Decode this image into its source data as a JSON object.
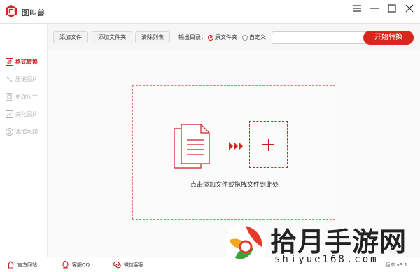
{
  "app": {
    "title": "图叫兽"
  },
  "window_controls": {
    "menu": "☰",
    "minimize": "—",
    "maximize": "☐",
    "close": "✕"
  },
  "sidebar": {
    "items": [
      {
        "label": "格式转换",
        "icon": "swap-icon",
        "active": true
      },
      {
        "label": "压缩图片",
        "icon": "compress-icon",
        "active": false
      },
      {
        "label": "更改尺寸",
        "icon": "resize-icon",
        "active": false
      },
      {
        "label": "美化图片",
        "icon": "beautify-icon",
        "active": false
      },
      {
        "label": "添加水印",
        "icon": "watermark-icon",
        "active": false
      }
    ]
  },
  "toolbar": {
    "add_file": "添加文件",
    "add_folder": "添加文件夹",
    "clear_list": "清除列表",
    "output_label": "输出目录：",
    "radio_original": "原文件夹",
    "radio_custom": "自定义",
    "path_value": "",
    "start": "开始转换"
  },
  "dropzone": {
    "hint": "点击添加文件或拖拽文件到此处"
  },
  "footer": {
    "website": "官方网站",
    "qq": "客服QQ",
    "wechat": "微信客服",
    "version": "版本 v3.1"
  },
  "watermark": {
    "title": "拾月手游网",
    "url": "shiyue168.com"
  },
  "colors": {
    "accent": "#d9261c",
    "sidebar_inactive": "#b0b0b0"
  }
}
